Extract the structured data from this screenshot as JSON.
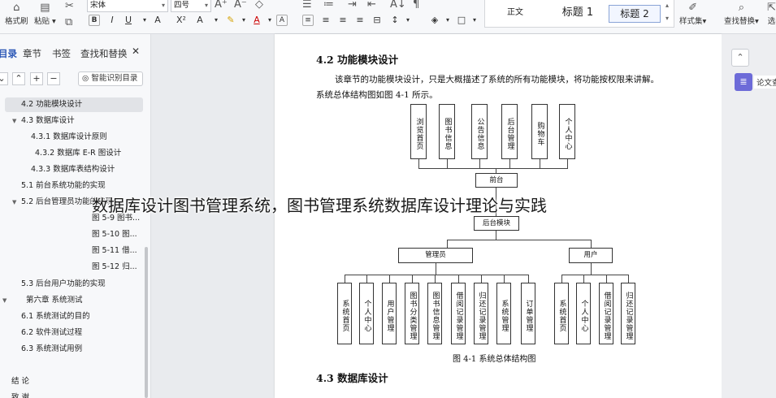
{
  "ribbon": {
    "format_painter": "格式刷",
    "paste": "粘贴",
    "font_name": "宋体",
    "font_size": "四号",
    "styles": {
      "normal": "正文",
      "heading1": "标题 1",
      "heading2": "标题 2"
    },
    "style_set": "样式集",
    "find_replace": "查找替换",
    "select": "选"
  },
  "nav": {
    "tabs": {
      "toc": "目录",
      "sections": "章节",
      "bookmarks": "书签",
      "find": "查找和替换"
    },
    "smart_toc": "智能识别目录",
    "items": [
      "4.2 功能模块设计",
      "4.3  数据库设计",
      "4.3.1 数据库设计原则",
      "4.3.2 数据库 E-R 图设计",
      "4.3.3 数据库表结构设计",
      "5.1 前台系统功能的实现",
      "5.2  后台管理员功能的实现",
      "图 5-9 图书...",
      "图 5-10 图...",
      "图 5-11 借...",
      "图 5-12 归...",
      "5.3 后台用户功能的实现",
      "第六章  系统测试",
      "6.1 系统测试的目的",
      "6.2 软件测试过程",
      "6.3 系统测试用例",
      "结    论",
      "致    谢"
    ]
  },
  "document": {
    "heading_42": "4.2 功能模块设计",
    "para_line1": "该章节的功能模块设计，只是大概描述了系统的所有功能模块，将功能按权限来讲解。",
    "para_line2": "系统总体结构图如图 4-1 所示。",
    "diagram": {
      "top_boxes": [
        "浏览首页",
        "图书信息",
        "公告信息",
        "后台管理",
        "购物车",
        "个人中心"
      ],
      "front": "前台",
      "backend": "后台模块",
      "admin": "管理员",
      "user": "用户",
      "admin_boxes": [
        "系统首页",
        "个人中心",
        "用户管理",
        "图书分类管理",
        "图书信息管理",
        "借阅记录管理",
        "归还记录管理",
        "系统管理",
        "订单管理"
      ],
      "user_boxes": [
        "系统首页",
        "个人中心",
        "借阅记录管理",
        "归还记录管理"
      ]
    },
    "caption": "图 4-1  系统总体结构图",
    "heading_43": "4.3  数据库设计"
  },
  "rail": {
    "doc_label": "论文查"
  },
  "overlay_title": "数据库设计图书管理系统，图书管理系统数据库设计理论与实践"
}
